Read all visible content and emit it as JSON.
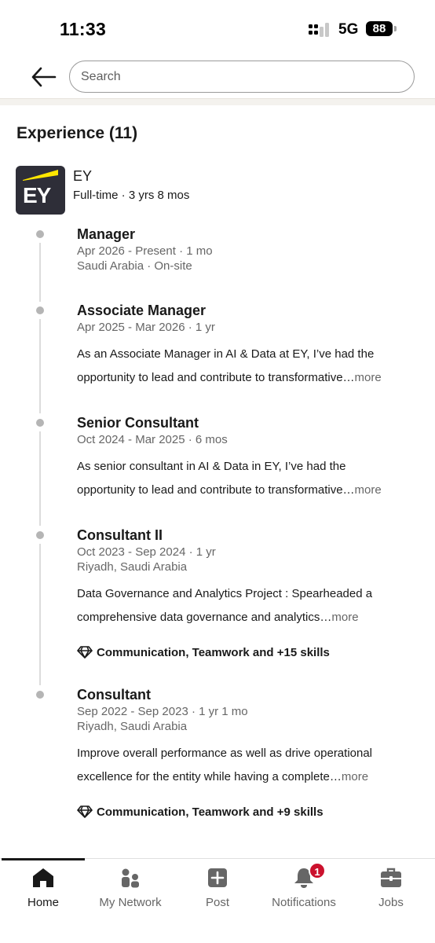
{
  "status_bar": {
    "time": "11:33",
    "network": "5G",
    "battery": "88"
  },
  "header": {
    "back_icon": "arrow-left-icon",
    "search": {
      "placeholder": "Search",
      "value": ""
    }
  },
  "section": {
    "title": "Experience (11)"
  },
  "company": {
    "logo_text": "EY",
    "name": "EY",
    "meta": "Full-time · 3 yrs 8 mos",
    "logo_colors": {
      "background": "#2e2e38",
      "accent": "#ffe600"
    }
  },
  "roles": [
    {
      "title": "Manager",
      "dates": "Apr 2026 - Present · 1 mo",
      "location": "Saudi Arabia · On-site"
    },
    {
      "title": "Associate Manager",
      "dates": "Apr 2025 - Mar 2026 · 1 yr",
      "desc_line1": "As an Associate Manager in AI & Data at EY, I’ve had the",
      "desc_line2": "opportunity to lead and contribute to transformative…",
      "more": "more"
    },
    {
      "title": "Senior Consultant",
      "dates": "Oct 2024 - Mar 2025 · 6 mos",
      "desc_line1": "As senior consultant in AI & Data in EY, I’ve had the",
      "desc_line2": "opportunity to lead and contribute to transformative…",
      "more": "more"
    },
    {
      "title": "Consultant II",
      "dates": "Oct 2023 - Sep 2024 · 1 yr",
      "location": "Riyadh, Saudi Arabia",
      "desc_line1": "Data Governance and Analytics Project : Spearheaded a",
      "desc_line2": "comprehensive data governance and analytics…",
      "more": "more",
      "skills": "Communication, Teamwork and +15 skills"
    },
    {
      "title": "Consultant",
      "dates": "Sep 2022 - Sep 2023 · 1 yr 1 mo",
      "location": "Riyadh, Saudi Arabia",
      "desc_line1": "Improve overall performance as well as drive operational",
      "desc_line2": "excellence for the entity while having a complete…",
      "more": "more",
      "skills": "Communication, Teamwork and +9 skills"
    }
  ],
  "bottom_nav": {
    "items": [
      {
        "label": "Home",
        "icon": "home-icon",
        "active": true
      },
      {
        "label": "My Network",
        "icon": "people-icon"
      },
      {
        "label": "Post",
        "icon": "plus-square-icon"
      },
      {
        "label": "Notifications",
        "icon": "bell-icon",
        "badge": "1"
      },
      {
        "label": "Jobs",
        "icon": "briefcase-icon"
      }
    ]
  },
  "colors": {
    "text_primary": "#191919",
    "text_secondary": "#666666",
    "badge": "#cb112d",
    "timeline": "#dcdcdc"
  }
}
